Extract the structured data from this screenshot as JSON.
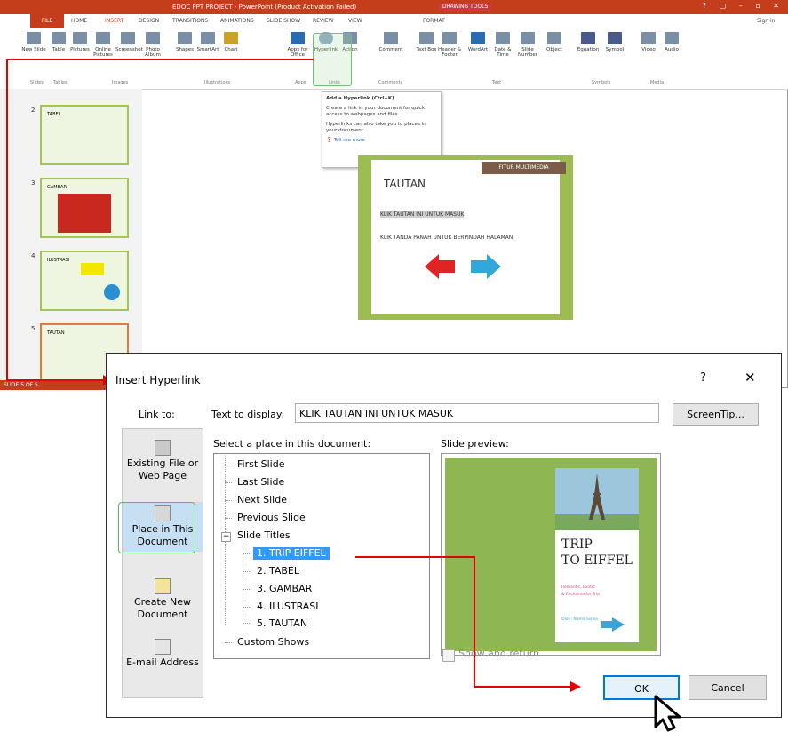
{
  "window": {
    "title": "EDOC PPT PROJECT - PowerPoint (Product Activation Failed)",
    "context_tab": "DRAWING TOOLS",
    "sign_in": "Sign in",
    "controls": "? ▢ – ▫ ✕"
  },
  "ribbon": {
    "tabs": [
      "FILE",
      "HOME",
      "INSERT",
      "DESIGN",
      "TRANSITIONS",
      "ANIMATIONS",
      "SLIDE SHOW",
      "REVIEW",
      "VIEW",
      "FORMAT"
    ],
    "active_tab": "INSERT",
    "buttons": [
      "New Slide",
      "Table",
      "Pictures",
      "Online Pictures",
      "Screenshot",
      "Photo Album",
      "Shapes",
      "SmartArt",
      "Chart",
      "Apps for Office",
      "Hyperlink",
      "Action",
      "Comment",
      "Text Box",
      "Header & Footer",
      "WordArt",
      "Date & Time",
      "Slide Number",
      "Object",
      "Equation",
      "Symbol",
      "Video",
      "Audio"
    ],
    "groups": [
      "Slides",
      "Tables",
      "Images",
      "Illustrations",
      "Apps",
      "Links",
      "Comments",
      "Text",
      "Symbols",
      "Media"
    ]
  },
  "tooltip": {
    "title": "Add a Hyperlink (Ctrl+K)",
    "body1": "Create a link in your document for quick access to webpages and files.",
    "body2": "Hyperlinks can also take you to places in your document.",
    "tell_more": "Tell me more"
  },
  "thumbnails": [
    {
      "num": "2",
      "title": "TABEL"
    },
    {
      "num": "3",
      "title": "GAMBAR"
    },
    {
      "num": "4",
      "title": "ILUSTRASI"
    },
    {
      "num": "5",
      "title": "TAUTAN"
    }
  ],
  "slide": {
    "header": "FITUR MULTIMEDIA",
    "title": "TAUTAN",
    "bullet1": "KLIK TAUTAN INI UNTUK MASUK",
    "bullet2": "KLIK TANDA PANAH UNTUK BERPINDAH HALAMAN"
  },
  "statusbar": {
    "text": "SLIDE 5 OF 5"
  },
  "dialog": {
    "title": "Insert Hyperlink",
    "help": "?",
    "close": "✕",
    "link_to_label": "Link to:",
    "link_to_options": [
      "Existing File or Web Page",
      "Place in This Document",
      "Create New Document",
      "E-mail Address"
    ],
    "text_to_display_label": "Text to display:",
    "text_to_display_value": "KLIK TAUTAN INI UNTUK MASUK",
    "screentip_button": "ScreenTip...",
    "place_label": "Select a place in this document:",
    "tree": {
      "first": "First Slide",
      "last": "Last Slide",
      "next": "Next Slide",
      "previous": "Previous Slide",
      "slide_titles": "Slide Titles",
      "slides": [
        "1. TRIP    EIFFEL",
        "2. TABEL",
        "3. GAMBAR",
        "4. ILUSTRASI",
        "5. TAUTAN"
      ],
      "selected_slide": "1. TRIP    EIFFEL",
      "custom_shows": "Custom Shows"
    },
    "preview_label": "Slide preview:",
    "preview": {
      "title_line1": "TRIP",
      "title_line2": "TO EIFFEL",
      "sub1": "Romantic, Exotic",
      "sub2": "& Exclusive for Trip",
      "sub3": "Oleh: Nama Siswa"
    },
    "show_and_return": "Show and return",
    "ok": "OK",
    "cancel": "Cancel"
  },
  "colors": {
    "accent_red": "#e30000",
    "ppt_brand": "#c43e1c",
    "selection_blue": "#3399ff",
    "highlight_green": "#5cb85c",
    "slide_green": "#9dbd52"
  }
}
